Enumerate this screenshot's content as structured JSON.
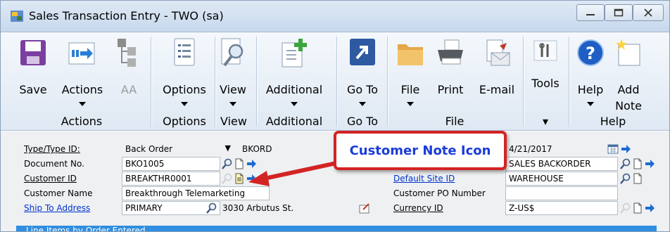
{
  "window": {
    "title": "Sales Transaction Entry  -  TWO (sa)",
    "controls": {
      "minimize_icon": "minimize-icon",
      "maximize_icon": "maximize-icon",
      "close_icon": "close-icon"
    }
  },
  "ribbon": {
    "buttons": {
      "save": "Save",
      "actions": "Actions",
      "aa": "AA",
      "options": "Options",
      "view": "View",
      "additional": "Additional",
      "goto": "Go To",
      "file": "File",
      "print": "Print",
      "email": "E-mail",
      "tools": "Tools",
      "help": "Help",
      "add_note_line1": "Add",
      "add_note_line2": "Note"
    },
    "groups": {
      "actions": "Actions",
      "options": "Options",
      "view": "View",
      "additional": "Additional",
      "goto": "Go To",
      "file": "File",
      "help": "Help"
    }
  },
  "form": {
    "labels": {
      "type": "Type/Type ID:",
      "document_no": "Document No.",
      "customer_id": "Customer ID",
      "customer_name": "Customer Name",
      "ship_to": "Ship To Address",
      "default_site": "Default Site ID",
      "customer_po": "Customer PO Number",
      "currency": "Currency ID"
    },
    "values": {
      "type": "Back Order",
      "type_id": "BKORD",
      "document_no": "BKO1005",
      "customer_id": "BREAKTHR0001",
      "customer_name": "Breakthrough Telemarketing",
      "ship_to": "PRIMARY",
      "ship_address": "3030 Arbutus St.",
      "date": "4/21/2017",
      "batch": "SALES BACKORDER",
      "default_site": "WAREHOUSE",
      "customer_po": "",
      "currency": "Z-US$"
    }
  },
  "annotation": {
    "callout_text": "Customer Note Icon"
  },
  "bottom_bar": {
    "text": "Line Items by Order Entered"
  },
  "colors": {
    "callout_border": "#d32424",
    "callout_text": "#1a3cd8",
    "link": "#0033cc",
    "arrow": "#d32424"
  }
}
